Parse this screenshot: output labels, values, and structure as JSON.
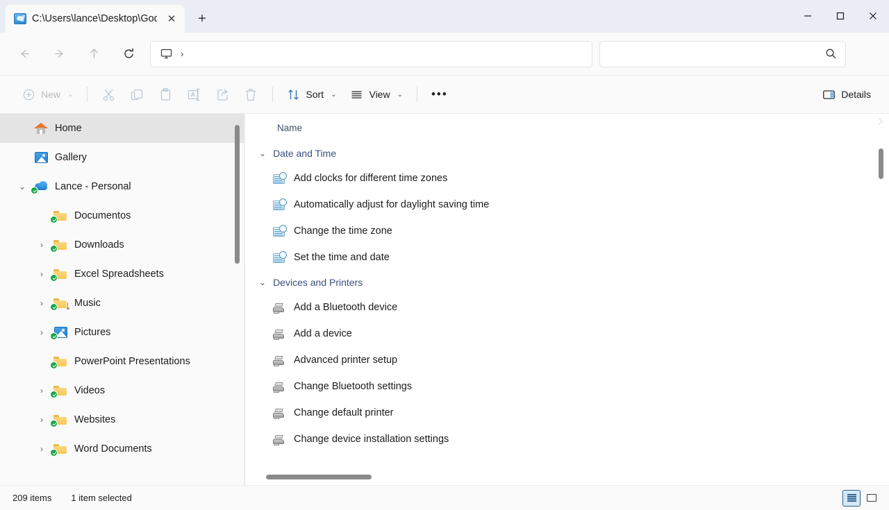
{
  "window": {
    "tab": {
      "title": "C:\\Users\\lance\\Desktop\\GodM",
      "icon": "control-panel-icon",
      "close_label": "✕"
    },
    "new_tab_label": "+",
    "controls": {
      "minimize": "minimize-icon",
      "maximize": "maximize-icon",
      "close": "close-icon"
    }
  },
  "addressbar": {
    "back": "back-arrow-icon",
    "forward": "forward-arrow-icon",
    "up": "up-arrow-icon",
    "refresh": "refresh-icon",
    "breadcrumb_icon": "this-pc-monitor-icon",
    "breadcrumb_chevron": "›",
    "search_placeholder": "",
    "search_value": "",
    "search_icon": "search-icon"
  },
  "commandbar": {
    "new": {
      "label": "New",
      "chevron": "⌄"
    },
    "cut": "cut-icon",
    "copy": "copy-icon",
    "paste": "paste-icon",
    "rename": "rename-icon",
    "share": "share-icon",
    "delete": "delete-icon",
    "sort": {
      "label": "Sort",
      "chevron": "⌄"
    },
    "view": {
      "label": "View",
      "chevron": "⌄"
    },
    "more": "•••",
    "details": {
      "label": "Details"
    }
  },
  "sidebar": {
    "items": [
      {
        "label": "Home",
        "icon": "home-icon",
        "level": 0,
        "chevron": "",
        "selected": true,
        "sync": false
      },
      {
        "label": "Gallery",
        "icon": "gallery-icon",
        "level": 0,
        "chevron": "",
        "selected": false,
        "sync": false
      },
      {
        "label": "Lance - Personal",
        "icon": "onedrive-cloud-icon",
        "level": 1,
        "chevron": "⌄",
        "selected": false,
        "sync": true
      },
      {
        "label": "Documentos",
        "icon": "folder-icon",
        "level": 2,
        "chevron": "",
        "selected": false,
        "sync": true
      },
      {
        "label": "Downloads",
        "icon": "folder-icon",
        "level": 2,
        "chevron": "›",
        "selected": false,
        "sync": true
      },
      {
        "label": "Excel Spreadsheets",
        "icon": "folder-icon",
        "level": 2,
        "chevron": "›",
        "selected": false,
        "sync": true
      },
      {
        "label": "Music",
        "icon": "music-folder-icon",
        "level": 2,
        "chevron": "›",
        "selected": false,
        "sync": true
      },
      {
        "label": "Pictures",
        "icon": "pictures-folder-icon",
        "level": 2,
        "chevron": "›",
        "selected": false,
        "sync": true
      },
      {
        "label": "PowerPoint Presentations",
        "icon": "folder-icon",
        "level": 2,
        "chevron": "",
        "selected": false,
        "sync": true
      },
      {
        "label": "Videos",
        "icon": "folder-icon",
        "level": 2,
        "chevron": "›",
        "selected": false,
        "sync": true
      },
      {
        "label": "Websites",
        "icon": "folder-icon",
        "level": 2,
        "chevron": "›",
        "selected": false,
        "sync": true
      },
      {
        "label": "Word Documents",
        "icon": "folder-icon",
        "level": 2,
        "chevron": "›",
        "selected": false,
        "sync": true
      }
    ]
  },
  "content": {
    "column_headers": [
      "Name"
    ],
    "groups": [
      {
        "name": "Date and Time",
        "chevron": "⌄",
        "items": [
          {
            "label": "Add clocks for different time zones",
            "icon": "date-time-icon"
          },
          {
            "label": "Automatically adjust for daylight saving time",
            "icon": "date-time-icon"
          },
          {
            "label": "Change the time zone",
            "icon": "date-time-icon"
          },
          {
            "label": "Set the time and date",
            "icon": "date-time-icon"
          }
        ]
      },
      {
        "name": "Devices and Printers",
        "chevron": "⌄",
        "items": [
          {
            "label": "Add a Bluetooth device",
            "icon": "printer-icon"
          },
          {
            "label": "Add a device",
            "icon": "printer-icon"
          },
          {
            "label": "Advanced printer setup",
            "icon": "printer-icon"
          },
          {
            "label": "Change Bluetooth settings",
            "icon": "printer-icon"
          },
          {
            "label": "Change default printer",
            "icon": "printer-icon"
          },
          {
            "label": "Change device installation settings",
            "icon": "printer-icon"
          }
        ]
      }
    ]
  },
  "statusbar": {
    "item_count": "209 items",
    "selection": "1 item selected",
    "view_details": "details-view-icon",
    "view_large_icons": "large-icons-view-icon"
  },
  "colors": {
    "accent": "#2d5e8c",
    "group_header": "#3c4f7c",
    "selected_row": "#e4e4e4",
    "titlebar": "#eaeef4",
    "chrome": "#fafafa",
    "sync_green": "#17a64a",
    "folder_yellow": "#f6c75a"
  }
}
